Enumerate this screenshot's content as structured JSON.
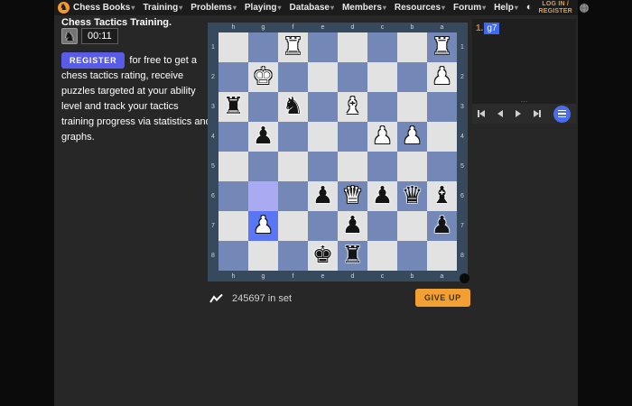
{
  "navbar": {
    "logo_icon": "knight-glyph",
    "items": [
      {
        "label": "Chess Books"
      },
      {
        "label": "Training"
      },
      {
        "label": "Problems"
      },
      {
        "label": "Playing"
      },
      {
        "label": "Database"
      },
      {
        "label": "Members"
      },
      {
        "label": "Resources"
      },
      {
        "label": "Forum"
      },
      {
        "label": "Help"
      }
    ],
    "caret": "▾",
    "theme_icon": "◐",
    "login_label": "LOG IN /\nREGISTER"
  },
  "sidebar": {
    "heading": "Chess Tactics Training.",
    "side_to_move_icon": "♞",
    "timer": "00:11",
    "register_button": "REGISTER",
    "register_text": "for free to get a chess tactics rating, receive puzzles targeted at your ability level and track your tactics training progress via statistics and graphs."
  },
  "board": {
    "files": [
      "h",
      "g",
      "f",
      "e",
      "d",
      "c",
      "b",
      "a"
    ],
    "ranks": [
      "1",
      "2",
      "3",
      "4",
      "5",
      "6",
      "7",
      "8"
    ],
    "colors": {
      "light_square": "#e2e2e2",
      "dark_square": "#7388b6",
      "border": "#36495d",
      "highlight_from": "#a9aaf2",
      "highlight_to": "#5b76f5"
    },
    "highlights": [
      {
        "square": "g6",
        "type": "from"
      },
      {
        "square": "g7",
        "type": "to"
      }
    ],
    "pieces": [
      {
        "square": "f1",
        "color": "white",
        "type": "rook"
      },
      {
        "square": "a1",
        "color": "white",
        "type": "rook"
      },
      {
        "square": "g2",
        "color": "white",
        "type": "king"
      },
      {
        "square": "a2",
        "color": "white",
        "type": "pawn"
      },
      {
        "square": "h3",
        "color": "black",
        "type": "rook"
      },
      {
        "square": "f3",
        "color": "black",
        "type": "knight"
      },
      {
        "square": "d3",
        "color": "white",
        "type": "bishop"
      },
      {
        "square": "g4",
        "color": "black",
        "type": "pawn"
      },
      {
        "square": "c4",
        "color": "white",
        "type": "pawn"
      },
      {
        "square": "b4",
        "color": "white",
        "type": "pawn"
      },
      {
        "square": "e6",
        "color": "black",
        "type": "pawn"
      },
      {
        "square": "d6",
        "color": "white",
        "type": "queen"
      },
      {
        "square": "c6",
        "color": "black",
        "type": "pawn"
      },
      {
        "square": "b6",
        "color": "black",
        "type": "queen"
      },
      {
        "square": "a6",
        "color": "black",
        "type": "bishop"
      },
      {
        "square": "g7",
        "color": "white",
        "type": "pawn"
      },
      {
        "square": "d7",
        "color": "black",
        "type": "pawn"
      },
      {
        "square": "a7",
        "color": "black",
        "type": "pawn"
      },
      {
        "square": "e8",
        "color": "black",
        "type": "king"
      },
      {
        "square": "d8",
        "color": "black",
        "type": "rook"
      }
    ],
    "piece_glyphs": {
      "king": "♚",
      "queen": "♛",
      "rook": "♜",
      "bishop": "♝",
      "knight": "♞",
      "pawn": "♟"
    }
  },
  "movelist": {
    "move_number": "1.",
    "move_san": "g7",
    "handle": "…"
  },
  "footer": {
    "chart_icon": "activity-line",
    "set_count": "245697 in set",
    "give_up_label": "GIVE UP"
  }
}
